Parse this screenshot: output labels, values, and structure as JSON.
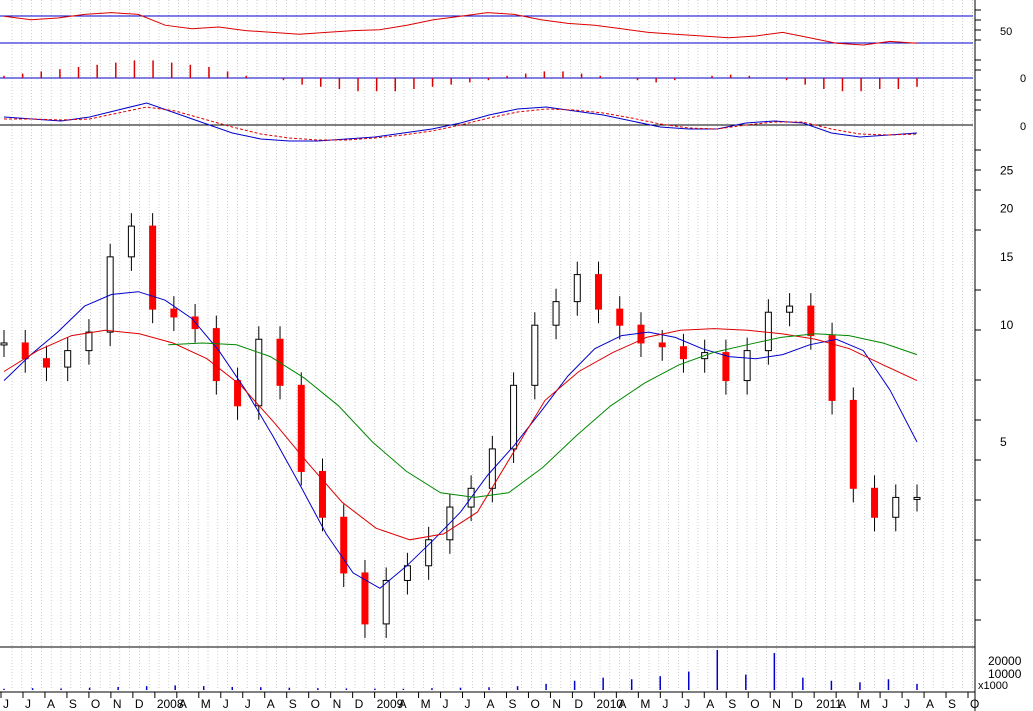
{
  "chart_data": [
    {
      "panel": "rsi",
      "type": "line",
      "y_ticks": [
        "50"
      ],
      "reference_levels": [
        50,
        30
      ],
      "series": [
        {
          "color": "#dd0000",
          "values": [
            62,
            58,
            60,
            64,
            66,
            64,
            52,
            48,
            50,
            46,
            44,
            42,
            44,
            46,
            47,
            52,
            58,
            62,
            66,
            64,
            58,
            54,
            52,
            48,
            44,
            42,
            40,
            38,
            40,
            44,
            38,
            32,
            30,
            34,
            32
          ]
        }
      ]
    },
    {
      "panel": "momentum",
      "type": "bar",
      "y_ticks": [
        "0"
      ],
      "color": "#dd0000",
      "values": [
        2,
        4,
        6,
        8,
        10,
        12,
        14,
        16,
        16,
        14,
        12,
        10,
        6,
        2,
        0,
        -2,
        -6,
        -8,
        -10,
        -12,
        -12,
        -12,
        -10,
        -8,
        -6,
        -4,
        -2,
        2,
        4,
        6,
        6,
        4,
        2,
        0,
        -2,
        -4,
        -2,
        0,
        2,
        3,
        2,
        0,
        -2,
        -6,
        -10,
        -12,
        -12,
        -10,
        -10,
        -8
      ]
    },
    {
      "panel": "macd",
      "type": "line",
      "y_ticks": [
        "0"
      ],
      "series": [
        {
          "color": "#0000cc",
          "values": [
            0.8,
            0.6,
            0.4,
            0.8,
            1.5,
            2.2,
            1.2,
            0.2,
            -0.8,
            -1.4,
            -1.6,
            -1.6,
            -1.4,
            -1.2,
            -0.8,
            -0.4,
            0.2,
            1.0,
            1.6,
            1.8,
            1.4,
            1.0,
            0.4,
            -0.2,
            -0.4,
            -0.4,
            0.2,
            0.4,
            0.2,
            -0.8,
            -1.2,
            -1.0,
            -0.8
          ]
        },
        {
          "color": "#dd0000",
          "values": [
            0.6,
            0.6,
            0.5,
            0.6,
            1.2,
            1.8,
            1.4,
            0.6,
            -0.2,
            -0.9,
            -1.3,
            -1.5,
            -1.5,
            -1.3,
            -1.0,
            -0.6,
            0.0,
            0.7,
            1.3,
            1.6,
            1.5,
            1.2,
            0.7,
            0.1,
            -0.3,
            -0.4,
            0.0,
            0.3,
            0.3,
            -0.4,
            -0.9,
            -1.0,
            -0.9
          ]
        }
      ]
    },
    {
      "panel": "price",
      "type": "candlestick",
      "scale": "log",
      "ylim": [
        1.5,
        30
      ],
      "y_ticks": [
        "25",
        "20",
        "15",
        "10",
        "5"
      ],
      "x_tick_labels": [
        "J",
        "J",
        "A",
        "S",
        "O",
        "N",
        "D",
        "2008",
        "A",
        "M",
        "J",
        "J",
        "A",
        "S",
        "O",
        "N",
        "D",
        "2009",
        "A",
        "M",
        "J",
        "J",
        "A",
        "S",
        "O",
        "N",
        "D",
        "2010",
        "A",
        "M",
        "J",
        "J",
        "A",
        "S",
        "O",
        "N",
        "D",
        "2011",
        "A",
        "M",
        "J",
        "J",
        "A",
        "S",
        "O"
      ],
      "close": [
        9,
        8.2,
        7.8,
        8.6,
        9.6,
        15,
        18,
        11,
        10.5,
        9.8,
        7.2,
        6.2,
        9.2,
        7,
        4.2,
        3.2,
        2.3,
        1.7,
        2.2,
        2.4,
        2.8,
        3.4,
        3.8,
        4.8,
        7,
        10,
        11.5,
        13.5,
        11,
        10,
        9,
        8.8,
        8.2,
        8.5,
        7.2,
        8.6,
        10.8,
        11.2,
        9.4,
        6.4,
        3.8,
        3.2,
        3.6,
        3.6
      ],
      "series": [
        {
          "name": "",
          "color": "#0000cc",
          "values": [
            7.2,
            8.4,
            9.6,
            11.2,
            12,
            12.2,
            11.6,
            10.4,
            8.6,
            6.8,
            5.2,
            3.9,
            2.9,
            2.3,
            2.1,
            2.4,
            2.8,
            3.3,
            4.1,
            4.9,
            6,
            7.4,
            8.7,
            9.4,
            9.6,
            9.3,
            8.7,
            8.3,
            8.2,
            8.4,
            8.9,
            9.2,
            8.6,
            6.8,
            5
          ]
        },
        {
          "name": "",
          "color": "#dd0000",
          "values": [
            7.6,
            8.6,
            9.4,
            9.7,
            9.5,
            9,
            8.2,
            7,
            5.6,
            4.4,
            3.5,
            3,
            2.8,
            2.9,
            3.3,
            4.6,
            6.4,
            7.6,
            8.5,
            9.3,
            9.7,
            9.8,
            9.7,
            9.5,
            9.2,
            8.7,
            7.9,
            7.2
          ]
        },
        {
          "name": "",
          "color": "#008800",
          "values": [
            8.9,
            9,
            8.9,
            8.3,
            7.3,
            6.2,
            5,
            4.2,
            3.7,
            3.6,
            3.7,
            4.3,
            5.2,
            6.2,
            7.1,
            7.9,
            8.5,
            8.9,
            9.3,
            9.5,
            9.4,
            9,
            8.4
          ]
        }
      ]
    },
    {
      "panel": "volume",
      "type": "bar",
      "y_ticks": [
        "20000",
        "10000"
      ],
      "unit_label": "x1000",
      "color": "#0000cc",
      "values": [
        800,
        1200,
        1000,
        1500,
        2000,
        2500,
        3000,
        2500,
        2000,
        1800,
        1500,
        1200,
        1000,
        900,
        800,
        1200,
        1500,
        1800,
        2500,
        4000,
        6000,
        8000,
        7000,
        9000,
        12000,
        26000,
        10000,
        24000,
        8000,
        6000,
        5000,
        7000,
        4000
      ]
    }
  ]
}
